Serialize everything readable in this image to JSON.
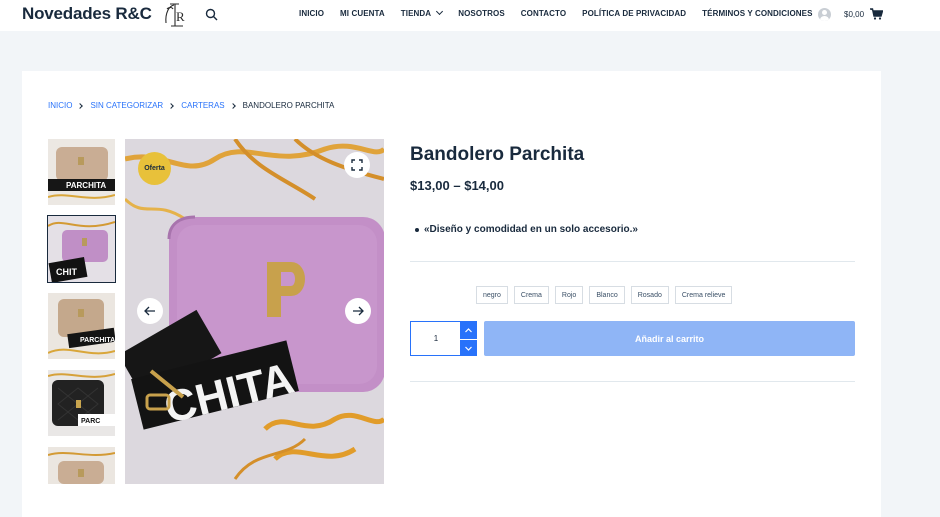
{
  "header": {
    "site_title": "Novedades R&C",
    "logo_text": "R",
    "nav": [
      {
        "label": "INICIO"
      },
      {
        "label": "MI CUENTA"
      },
      {
        "label": "TIENDA"
      },
      {
        "label": "NOSOTROS"
      },
      {
        "label": "CONTACTO"
      },
      {
        "label": "POLÍTICA DE PRIVACIDAD"
      },
      {
        "label": "TÉRMINOS Y CONDICIONES"
      }
    ],
    "cart_total": "$0,00"
  },
  "breadcrumb": [
    "INICIO",
    "SIN CATEGORIZAR",
    "CARTERAS",
    "BANDOLERO PARCHITA"
  ],
  "gallery": {
    "sale_badge": "Oferta",
    "thumb_count": 5,
    "active_thumb": 2
  },
  "product": {
    "title": "Bandolero Parchita",
    "price": "$13,00 – $14,00",
    "description": "«Diseño y comodidad en un solo accesorio.»",
    "variations": [
      "negro",
      "Crema",
      "Rojo",
      "Blanco",
      "Rosado",
      "Crema relieve"
    ],
    "quantity": "1",
    "add_to_cart": "Añadir al carrito"
  },
  "icons": {
    "search": "search-icon",
    "account": "user-icon",
    "cart": "cart-icon",
    "zoom": "fullscreen-icon",
    "prev": "arrow-left-icon",
    "next": "arrow-right-icon"
  },
  "colors": {
    "accent": "#2872fa",
    "button_disabled": "#8fb5f6",
    "badge": "#e8c13a",
    "text": "#192a3d",
    "background": "#f2f5f8"
  }
}
